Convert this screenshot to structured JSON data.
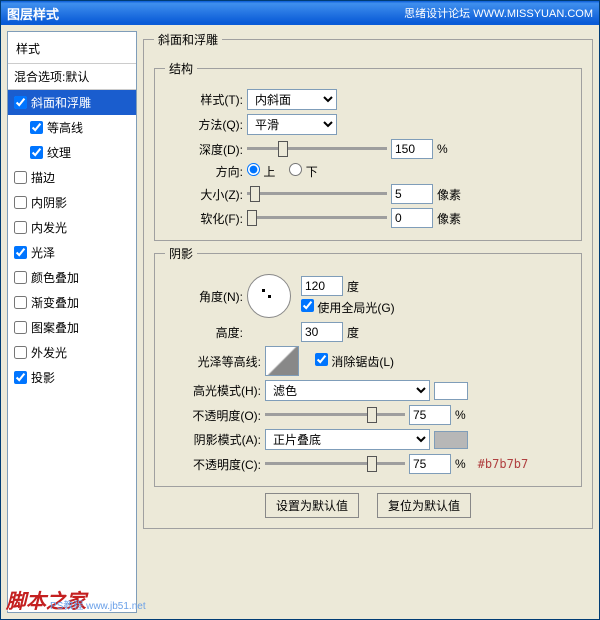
{
  "titlebar": {
    "title": "图层样式",
    "right": "思绪设计论坛  WWW.MISSYUAN.COM"
  },
  "sidebar": {
    "header": "样式",
    "blend": "混合选项:默认",
    "items": [
      {
        "name": "bevel",
        "label": "斜面和浮雕",
        "checked": true,
        "selected": true
      },
      {
        "name": "contour",
        "label": "等高线",
        "checked": true,
        "selected": false,
        "nested": true
      },
      {
        "name": "texture",
        "label": "纹理",
        "checked": true,
        "selected": false,
        "nested": true
      },
      {
        "name": "stroke",
        "label": "描边",
        "checked": false,
        "selected": false
      },
      {
        "name": "innerSh",
        "label": "内阴影",
        "checked": false,
        "selected": false
      },
      {
        "name": "innerGl",
        "label": "内发光",
        "checked": false,
        "selected": false
      },
      {
        "name": "satin",
        "label": "光泽",
        "checked": true,
        "selected": false
      },
      {
        "name": "colorOv",
        "label": "颜色叠加",
        "checked": false,
        "selected": false
      },
      {
        "name": "gradOv",
        "label": "渐变叠加",
        "checked": false,
        "selected": false
      },
      {
        "name": "pattOv",
        "label": "图案叠加",
        "checked": false,
        "selected": false
      },
      {
        "name": "outerGl",
        "label": "外发光",
        "checked": false,
        "selected": false
      },
      {
        "name": "dropSh",
        "label": "投影",
        "checked": true,
        "selected": false
      }
    ]
  },
  "panel": {
    "title": "斜面和浮雕",
    "structure": {
      "legend": "结构",
      "style_label": "样式(T):",
      "style_value": "内斜面",
      "tech_label": "方法(Q):",
      "tech_value": "平滑",
      "depth_label": "深度(D):",
      "depth_value": "150",
      "depth_unit": "%",
      "dir_label": "方向:",
      "dir_up": "上",
      "dir_down": "下",
      "size_label": "大小(Z):",
      "size_value": "5",
      "size_unit": "像素",
      "soften_label": "软化(F):",
      "soften_value": "0",
      "soften_unit": "像素"
    },
    "shading": {
      "legend": "阴影",
      "angle_label": "角度(N):",
      "angle_value": "120",
      "angle_unit": "度",
      "global_label": "使用全局光(G)",
      "alt_label": "高度:",
      "alt_value": "30",
      "alt_unit": "度",
      "gloss_label": "光泽等高线:",
      "antialias_label": "消除锯齿(L)",
      "hmode_label": "高光模式(H):",
      "hmode_value": "滤色",
      "hopac_label": "不透明度(O):",
      "hopac_value": "75",
      "hopac_unit": "%",
      "smode_label": "阴影模式(A):",
      "smode_value": "正片叠底",
      "sopac_label": "不透明度(C):",
      "sopac_value": "75",
      "sopac_unit": "%",
      "note": "#b7b7b7"
    },
    "buttons": {
      "default": "设置为默认值",
      "reset": "复位为默认值"
    }
  },
  "watermark": {
    "big": "脚本之家",
    "small": "PS教程  www.jb51.net"
  },
  "colors": {
    "highlight": "#ffffff",
    "shadowSwatch": "#b7b7b7"
  }
}
